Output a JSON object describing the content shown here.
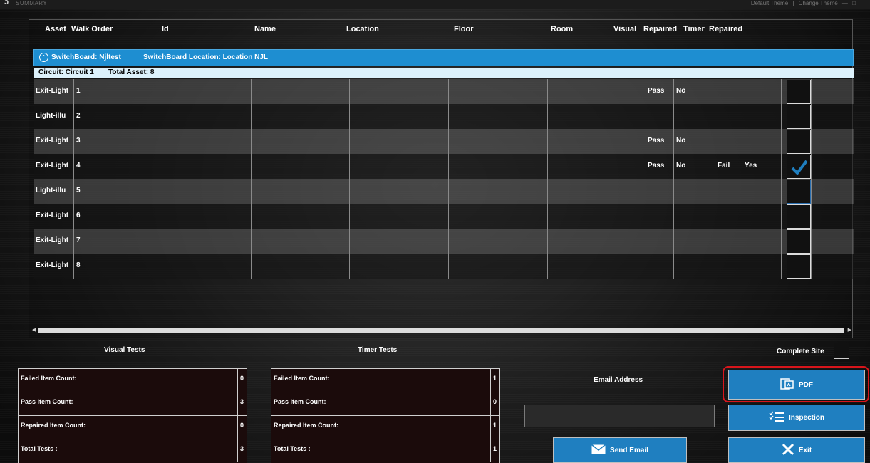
{
  "window": {
    "title": "SUMMARY",
    "theme_links": [
      "Default Theme",
      "|",
      "Change Theme",
      "—",
      "□"
    ]
  },
  "grid": {
    "headers": {
      "asset": "Asset",
      "walk_order": "Walk Order",
      "id": "Id",
      "name": "Name",
      "location": "Location",
      "floor": "Floor",
      "room": "Room",
      "visual": "Visual",
      "visual_repaired": "Repaired",
      "timer": "Timer",
      "timer_repaired": "Repaired"
    },
    "group": {
      "switchboard": "SwitchBoard: Njltest",
      "location": "SwitchBoard Location: Location NJL"
    },
    "circuit": {
      "name": "Circuit: Circuit 1",
      "total": "Total Asset: 8"
    },
    "rows": [
      {
        "asset": "Exit-Light",
        "walk_order": "1",
        "visual": "Pass",
        "visual_repaired": "No",
        "timer": "",
        "timer_repaired": "",
        "checked": false
      },
      {
        "asset": "Light-illu",
        "walk_order": "2",
        "visual": "",
        "visual_repaired": "",
        "timer": "",
        "timer_repaired": "",
        "checked": false
      },
      {
        "asset": "Exit-Light",
        "walk_order": "3",
        "visual": "Pass",
        "visual_repaired": "No",
        "timer": "",
        "timer_repaired": "",
        "checked": false
      },
      {
        "asset": "Exit-Light",
        "walk_order": "4",
        "visual": "Pass",
        "visual_repaired": "No",
        "timer": "Fail",
        "timer_repaired": "Yes",
        "checked": true
      },
      {
        "asset": "Light-illu",
        "walk_order": "5",
        "visual": "",
        "visual_repaired": "",
        "timer": "",
        "timer_repaired": "",
        "checked": false,
        "focused": true
      },
      {
        "asset": "Exit-Light",
        "walk_order": "6",
        "visual": "",
        "visual_repaired": "",
        "timer": "",
        "timer_repaired": "",
        "checked": false
      },
      {
        "asset": "Exit-Light",
        "walk_order": "7",
        "visual": "",
        "visual_repaired": "",
        "timer": "",
        "timer_repaired": "",
        "checked": false
      },
      {
        "asset": "Exit-Light",
        "walk_order": "8",
        "visual": "",
        "visual_repaired": "",
        "timer": "",
        "timer_repaired": "",
        "checked": false
      }
    ]
  },
  "visual_tests": {
    "title": "Visual Tests",
    "stats": [
      {
        "label": "Failed Item Count:",
        "value": "0"
      },
      {
        "label": "Pass Item Count:",
        "value": "3"
      },
      {
        "label": "Repaired Item Count:",
        "value": "0"
      },
      {
        "label": "Total Tests :",
        "value": "3"
      }
    ]
  },
  "timer_tests": {
    "title": "Timer Tests",
    "stats": [
      {
        "label": "Failed Item Count:",
        "value": "1"
      },
      {
        "label": "Pass Item Count:",
        "value": "0"
      },
      {
        "label": "Repaired Item Count:",
        "value": "1"
      },
      {
        "label": "Total Tests :",
        "value": "1"
      }
    ]
  },
  "email": {
    "label": "Email Address",
    "value": "",
    "send_label": "Send Email"
  },
  "complete_site": {
    "label": "Complete Site",
    "checked": false
  },
  "buttons": {
    "pdf": "PDF",
    "inspection": "Inspection",
    "exit": "Exit"
  },
  "colors": {
    "accent": "#1f7fc0",
    "group_bar": "#1e8ed1",
    "circuit_bar": "#dcf1fb",
    "highlight": "#d8151b",
    "check": "#1f7fc0"
  }
}
